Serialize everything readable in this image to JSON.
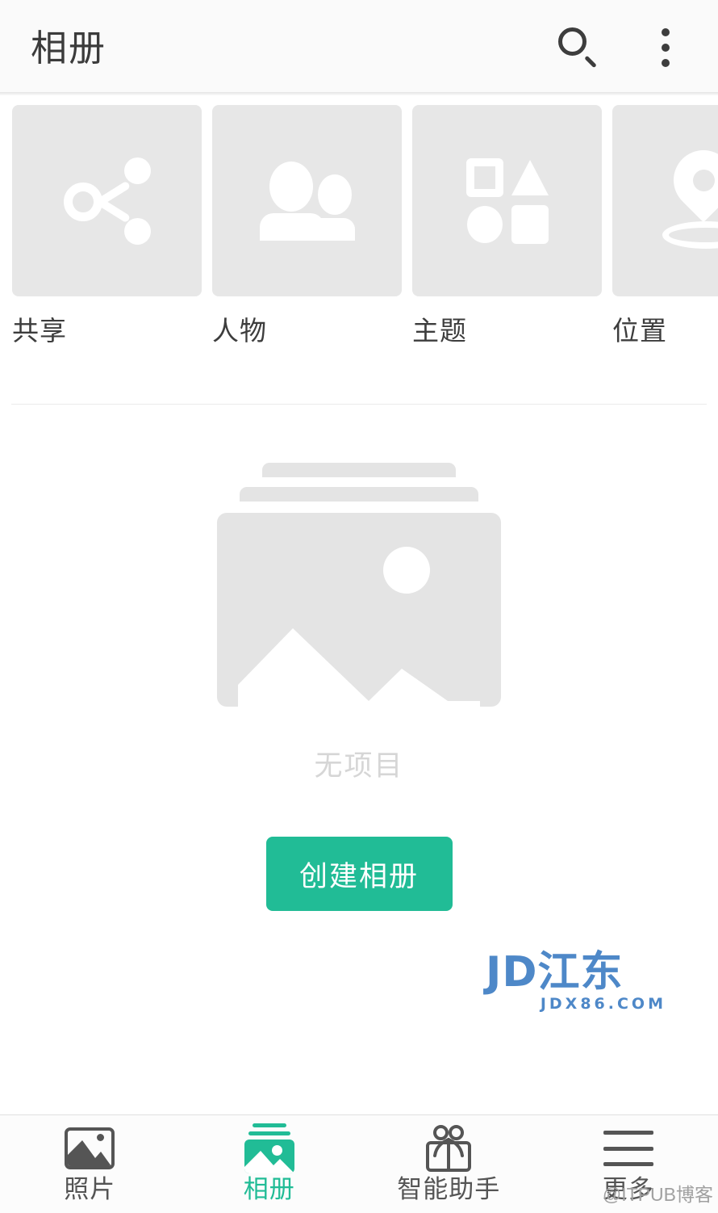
{
  "app": {
    "title": "相册",
    "accent_color": "#21bc96",
    "tile_bg_color": "#e7e7e7",
    "appbar_bg_color": "#fafafa"
  },
  "appbar": {
    "title": "相册",
    "search_icon": "search-icon",
    "overflow_icon": "more-vertical-icon"
  },
  "categories": [
    {
      "label": "共享",
      "icon": "share-icon"
    },
    {
      "label": "人物",
      "icon": "people-icon"
    },
    {
      "label": "主题",
      "icon": "shapes-icon"
    },
    {
      "label": "位置",
      "icon": "location-pin-icon"
    }
  ],
  "empty_state": {
    "illustration_icon": "photo-stack-placeholder-icon",
    "message": "无项目",
    "button_label": "创建相册"
  },
  "watermarks": {
    "jd_main": "JD江东",
    "jd_sub": "JDX86.COM",
    "itpub": "@ITPUB博客"
  },
  "bottom_nav": {
    "active_index": 1,
    "items": [
      {
        "label": "照片",
        "icon": "photo-icon"
      },
      {
        "label": "相册",
        "icon": "album-icon"
      },
      {
        "label": "智能助手",
        "icon": "gift-icon"
      },
      {
        "label": "更多",
        "icon": "hamburger-menu-icon"
      }
    ]
  }
}
